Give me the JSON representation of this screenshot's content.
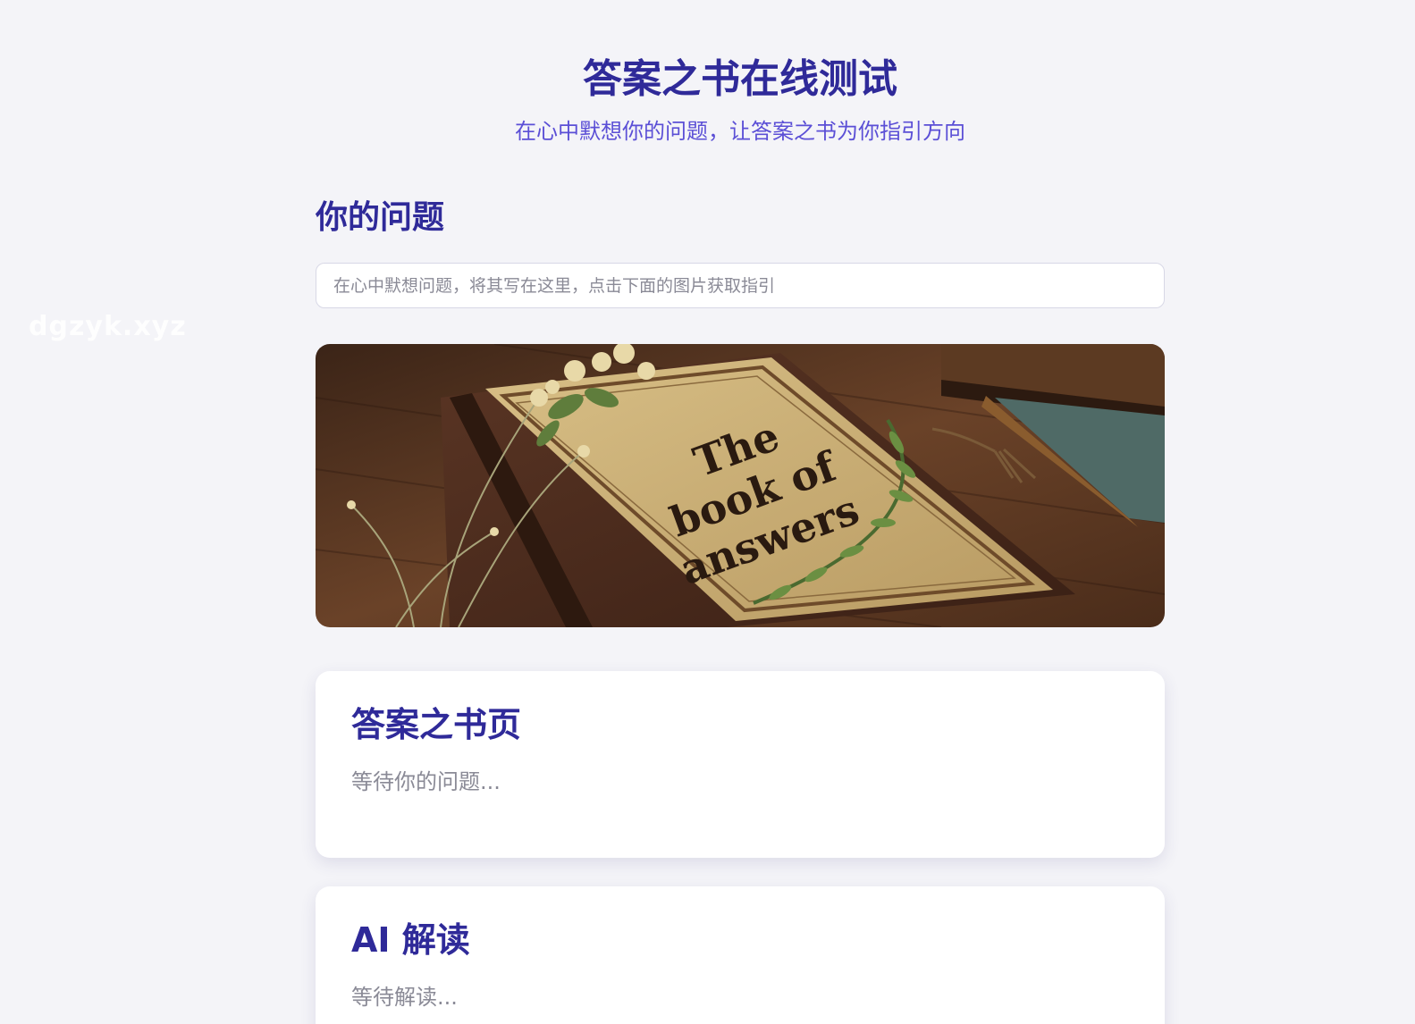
{
  "watermark": "dgzyk.xyz",
  "header": {
    "title": "答案之书在线测试",
    "subtitle": "在心中默想你的问题，让答案之书为你指引方向"
  },
  "question": {
    "section_title": "你的问题",
    "input_value": "",
    "input_placeholder": "在心中默想问题，将其写在这里，点击下面的图片获取指引"
  },
  "book_image": {
    "cover_text": [
      "The",
      "book of",
      "answers"
    ]
  },
  "answer_card": {
    "title": "答案之书页",
    "text": "等待你的问题..."
  },
  "ai_card": {
    "title": "AI 解读",
    "text": "等待解读..."
  },
  "colors": {
    "accent": "#2f2a99",
    "subtitle": "#5b4fd6",
    "muted": "#8a8a96",
    "background": "#f4f4f8"
  }
}
